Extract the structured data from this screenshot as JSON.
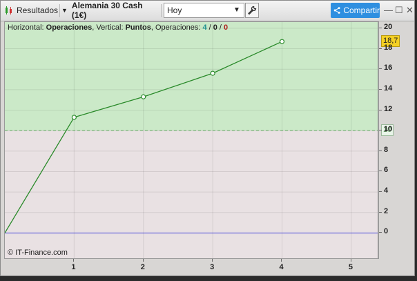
{
  "toolbar": {
    "results_label": "Resultados",
    "instrument_label": "Alemania 30 Cash (1€)",
    "period_value": "Hoy",
    "share_label": "Compartir"
  },
  "chart_header": {
    "horizontal_label": "Horizontal: ",
    "horizontal_value": "Operaciones",
    "vertical_label": ", Vertical: ",
    "vertical_value": "Puntos",
    "ops_label": ", Operaciones: ",
    "ops_total": "4",
    "ops_sep1": " / ",
    "ops_mid": "0",
    "ops_sep2": " / ",
    "ops_last": "0"
  },
  "copyright": "© IT-Finance.com",
  "markers": {
    "last_value": "18,7",
    "threshold_value": "10"
  },
  "colors": {
    "upper_zone": "#cbe9c8",
    "lower_zone": "#e9e1e3",
    "line": "#2a8a2a",
    "zero_line": "#3a3ad8",
    "threshold": "#6aaa6a",
    "share_button": "#2e8fe0"
  },
  "chart_data": {
    "type": "line",
    "x": [
      0,
      1,
      2,
      3,
      4
    ],
    "y": [
      0,
      11.3,
      13.3,
      15.6,
      18.7
    ],
    "xlim": [
      0,
      5.4
    ],
    "ylim": [
      -2.6,
      20.6
    ],
    "x_ticks": [
      "1",
      "2",
      "3",
      "4",
      "5"
    ],
    "y_ticks": [
      "0",
      "2",
      "4",
      "6",
      "8",
      "10",
      "12",
      "14",
      "16",
      "18",
      "20"
    ],
    "threshold": 10,
    "grid": true
  }
}
